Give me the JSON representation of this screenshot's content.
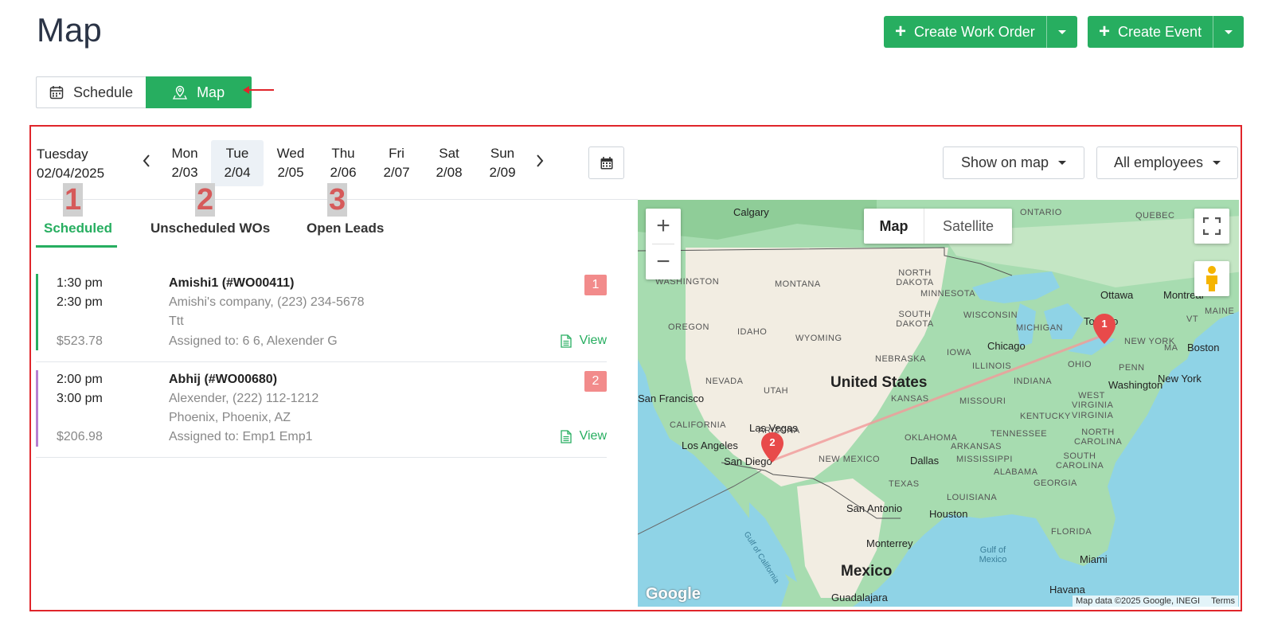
{
  "header": {
    "title": "Map",
    "create_work_order": "Create Work Order",
    "create_event": "Create Event"
  },
  "view_toggle": {
    "schedule": "Schedule",
    "map": "Map"
  },
  "date_nav": {
    "current_weekday": "Tuesday",
    "current_date": "02/04/2025",
    "days": [
      {
        "name": "Mon",
        "date": "2/03"
      },
      {
        "name": "Tue",
        "date": "2/04"
      },
      {
        "name": "Wed",
        "date": "2/05"
      },
      {
        "name": "Thu",
        "date": "2/06"
      },
      {
        "name": "Fri",
        "date": "2/07"
      },
      {
        "name": "Sat",
        "date": "2/08"
      },
      {
        "name": "Sun",
        "date": "2/09"
      }
    ],
    "selected_day_index": 1
  },
  "filters": {
    "show_on_map": "Show on map",
    "employees": "All employees"
  },
  "annotations": [
    "1",
    "2",
    "3"
  ],
  "tabs": [
    {
      "label": "Scheduled",
      "active": true
    },
    {
      "label": "Unscheduled WOs",
      "active": false
    },
    {
      "label": "Open Leads",
      "active": false
    }
  ],
  "work_orders": [
    {
      "start": "1:30 pm",
      "end": "2:30 pm",
      "price": "$523.78",
      "title": "Amishi1 (#WO00411)",
      "customer": "Amishi's company, (223) 234-5678",
      "location": "Ttt",
      "assigned": "Assigned to: 6 6, Alexender G",
      "badge": "1",
      "view": "View",
      "color": "#27ae60"
    },
    {
      "start": "2:00 pm",
      "end": "3:00 pm",
      "price": "$206.98",
      "title": "Abhij (#WO00680)",
      "customer": "Alexender, (222) 112-1212",
      "location": "Phoenix, Phoenix, AZ",
      "assigned": "Assigned to: Emp1 Emp1",
      "badge": "2",
      "view": "View",
      "color": "#b77fd0"
    }
  ],
  "map": {
    "type_map": "Map",
    "type_satellite": "Satellite",
    "zoom_in": "+",
    "zoom_out": "−",
    "logo": "Google",
    "attribution": "Map data ©2025 Google, INEGI",
    "terms": "Terms",
    "country_labels": [
      "United States",
      "Mexico"
    ],
    "region_labels": [
      "ONTARIO",
      "QUEBEC",
      "NORTH DAKOTA",
      "MONTANA",
      "WASHINGTON",
      "MINNESOTA",
      "WISCONSIN",
      "MICHIGAN",
      "SOUTH DAKOTA",
      "OREGON",
      "IDAHO",
      "WYOMING",
      "NEBRASKA",
      "IOWA",
      "ILLINOIS",
      "INDIANA",
      "OHIO",
      "PENN",
      "NEVADA",
      "UTAH",
      "KANSAS",
      "MISSOURI",
      "KENTUCKY",
      "WEST VIRGINIA",
      "VIRGINIA",
      "CALIFORNIA",
      "ARIZONA",
      "NEW MEXICO",
      "OKLAHOMA",
      "TENNESSEE",
      "NORTH CAROLINA",
      "SOUTH CAROLINA",
      "ARKANSAS",
      "MISSISSIPPI",
      "ALABAMA",
      "GEORGIA",
      "TEXAS",
      "LOUISIANA",
      "FLORIDA",
      "NEW YORK",
      "MAINE",
      "VT",
      "MA"
    ],
    "city_labels": [
      "Calgary",
      "Ottawa",
      "Montreal",
      "Toronto",
      "Boston",
      "Chicago",
      "New York",
      "Washington",
      "San Francisco",
      "Las Vegas",
      "Los Angeles",
      "San Diego",
      "Dallas",
      "San Antonio",
      "Houston",
      "Monterrey",
      "Miami",
      "Havana",
      "Guadalajara",
      "Gulf of Mexico",
      "Gulf of California"
    ],
    "markers": [
      "1",
      "2"
    ]
  }
}
